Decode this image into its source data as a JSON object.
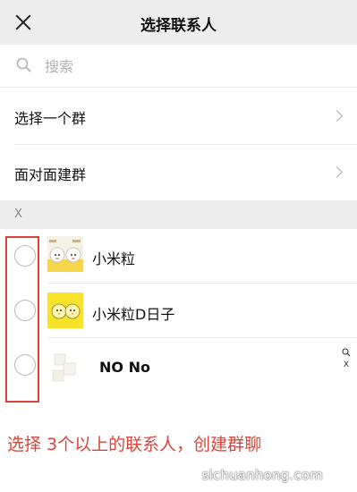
{
  "header": {
    "title": "选择联系人",
    "close_icon": "close-icon"
  },
  "search": {
    "placeholder": "搜索",
    "value": "",
    "icon": "search-icon"
  },
  "menu": [
    {
      "label": "选择一个群",
      "icon": "chevron-right-icon"
    },
    {
      "label": "面对面建群",
      "icon": "chevron-right-icon"
    }
  ],
  "section": {
    "letter": "X"
  },
  "contacts": [
    {
      "name": "小米粒",
      "avatar": "sheep-cartoon-avatar",
      "selected": false
    },
    {
      "name": "小米粒D日子",
      "avatar": "chick-cartoon-avatar",
      "selected": false
    },
    {
      "name": "NO No",
      "avatar": "white-cube-avatar",
      "selected": false
    }
  ],
  "index_bar": {
    "search_icon": "search-icon",
    "letter": "X"
  },
  "instruction": "选择 3个以上的联系人，创建群聊",
  "watermark": "sichuanhong.com",
  "colors": {
    "header_bg": "#ededed",
    "accent_red": "#d9443a",
    "chick_yellow": "#f9e22a"
  }
}
